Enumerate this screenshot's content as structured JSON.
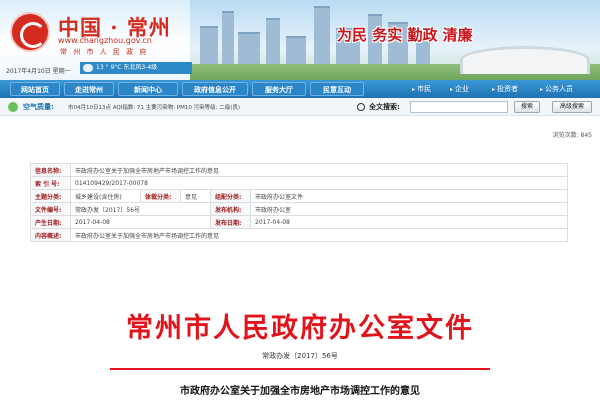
{
  "header": {
    "logo_title": "中国 · 常州",
    "logo_url": "www.changzhou.gov.cn",
    "logo_subtitle": "常 州 市 人 民 政 府",
    "date": "2017年4月10日 星期一",
    "weather": "13 ° 9°C 东北风3-4级",
    "slogan": "为民 务实 勤政 清廉"
  },
  "nav": {
    "items": [
      "网站首页",
      "走进常州",
      "新闻中心",
      "政府信息公开",
      "服务大厅",
      "民意互动"
    ],
    "quick_links": [
      "市民",
      "企业",
      "投资者",
      "公务人员"
    ]
  },
  "air": {
    "label": "空气质量:",
    "text": "市04月10日13点 AQI指数: 71  主要污染物: PM10  污染等级: 二级(良)"
  },
  "search": {
    "label": "全文搜索:",
    "placeholder": "",
    "search_button": "搜索",
    "advanced_button": "高级搜索"
  },
  "visits": "浏览次数: 845",
  "info": {
    "name_label": "信息名称:",
    "name_value": "市政府办公室关于加强全市房地产市场调控工作的意见",
    "index_label": "索 引 号:",
    "index_value": "014109429/2017-00078",
    "topic_label": "主题分类:",
    "topic_value": "城乡建设(含住房)",
    "genre_label": "体裁分类:",
    "genre_value": "意见",
    "org_category_label": "组配分类:",
    "org_category_value": "市政府办公室文件",
    "doc_no_label": "文件编号:",
    "doc_no_value": "常政办发〔2017〕56号",
    "publisher_label": "发布机构:",
    "publisher_value": "市政府办公室",
    "created_label": "产生日期:",
    "created_value": "2017-04-08",
    "published_label": "发布日期:",
    "published_value": "2017-04-08",
    "summary_label": "内容概述:",
    "summary_value": "市政府办公室关于加强全市房地产市场调控工作的意见"
  },
  "document": {
    "title": "常州市人民政府办公室文件",
    "number": "常政办发〔2017〕56号",
    "subject": "市政府办公室关于加强全市房地产市场调控工作的意见"
  },
  "colors": {
    "brand_red": "#e2141b",
    "nav_blue": "#1e73b5",
    "label_red": "#a01d1d"
  }
}
